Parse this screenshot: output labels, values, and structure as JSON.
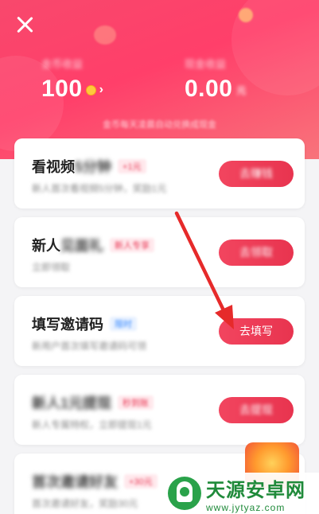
{
  "header": {
    "coin_label": "金币收益",
    "coin_value": "100",
    "cash_label": "现金收益",
    "cash_value": "0.00",
    "cash_unit": "元",
    "notice": "金币每天凌晨自动兑换成现金"
  },
  "tasks": [
    {
      "title": "看视频",
      "title_blur": "5分钟",
      "tag": "+1元",
      "desc": "新人首次看视频5分钟，奖励1元",
      "button": "去赚钱"
    },
    {
      "title": "新人",
      "title_blur": "见面礼",
      "tag": "新人专享",
      "desc": "立即领取",
      "button": "去领取"
    },
    {
      "title": "填写邀请码",
      "title_blur": "",
      "tag": "限时",
      "desc": "新用户首次填写邀请码可领",
      "button": "去填写"
    },
    {
      "title": "新人1元提现",
      "title_blur": "",
      "tag": "秒到账",
      "desc": "新人专属特权，立即提现1元",
      "button": "去提现"
    },
    {
      "title": "首次邀请好友",
      "title_blur": "",
      "tag": "+30元",
      "desc": "首次邀请好友，奖励30元",
      "button": ""
    }
  ],
  "watermark": {
    "title": "天源安卓网",
    "url": "www.jytyaz.com"
  },
  "colors": {
    "brand": "#f8486c",
    "button": "#e8344f",
    "annotation_arrow": "#e62a2a"
  }
}
